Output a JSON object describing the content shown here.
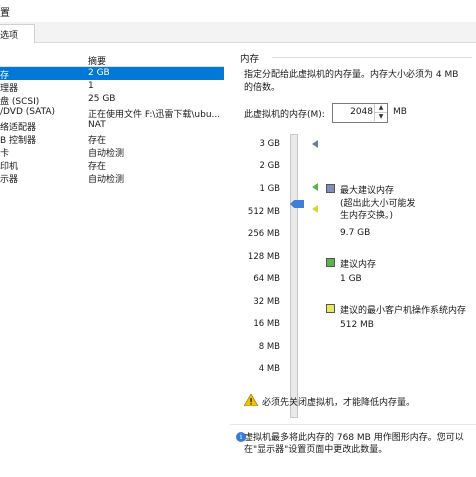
{
  "window": {
    "title": "置"
  },
  "tabs": [
    {
      "label": "选项"
    }
  ],
  "device_list": {
    "summary_header": "摘要",
    "rows": [
      {
        "device": "存",
        "summary": "2 GB",
        "selected": true
      },
      {
        "device": "理器",
        "summary": "1"
      },
      {
        "device": "盘 (SCSI)",
        "summary": "25 GB"
      },
      {
        "device": "/DVD (SATA)",
        "summary": "正在使用文件 F:\\迅雷下载\\ubu..."
      },
      {
        "device": "络适配器",
        "summary": "NAT"
      },
      {
        "device": "B 控制器",
        "summary": "存在"
      },
      {
        "device": "卡",
        "summary": "自动检测"
      },
      {
        "device": "印机",
        "summary": "存在"
      },
      {
        "device": "示器",
        "summary": "自动检测"
      }
    ]
  },
  "memory": {
    "group_title": "内存",
    "description": "指定分配给此虚拟机的内存量。内存大小必须为 4 MB 的倍数。",
    "field_label": "此虚拟机的内存(M):",
    "value": "2048",
    "unit": "MB",
    "scale_labels": [
      "3 GB",
      "2 GB",
      "1 GB",
      "512 MB",
      "256 MB",
      "128 MB",
      "64 MB",
      "32 MB",
      "16 MB",
      "8 MB",
      "4 MB"
    ],
    "legend": {
      "max_recommended_label": "最大建议内存",
      "max_recommended_note": "(超出此大小可能发生内存交换。)",
      "max_recommended_value": "9.7 GB",
      "recommended_label": "建议内存",
      "recommended_value": "1 GB",
      "guest_min_label": "建议的最小客户机操作系统内存",
      "guest_min_value": "512 MB"
    },
    "warning": "必须先关闭虚拟机，才能降低内存量。",
    "note": "虚拟机最多将此内存的 768 MB 用作图形内存。您可以在\"显示器\"设置页面中更改此数量。"
  },
  "colors": {
    "selection": "#0078d7",
    "slider_thumb": "#3d80d8",
    "recommended": "#5fb14a",
    "guest_min": "#e8e860",
    "max_recommended": "#7f8fb8"
  },
  "icons": [
    "warning-icon",
    "info-icon",
    "spin-up-icon",
    "spin-down-icon"
  ]
}
